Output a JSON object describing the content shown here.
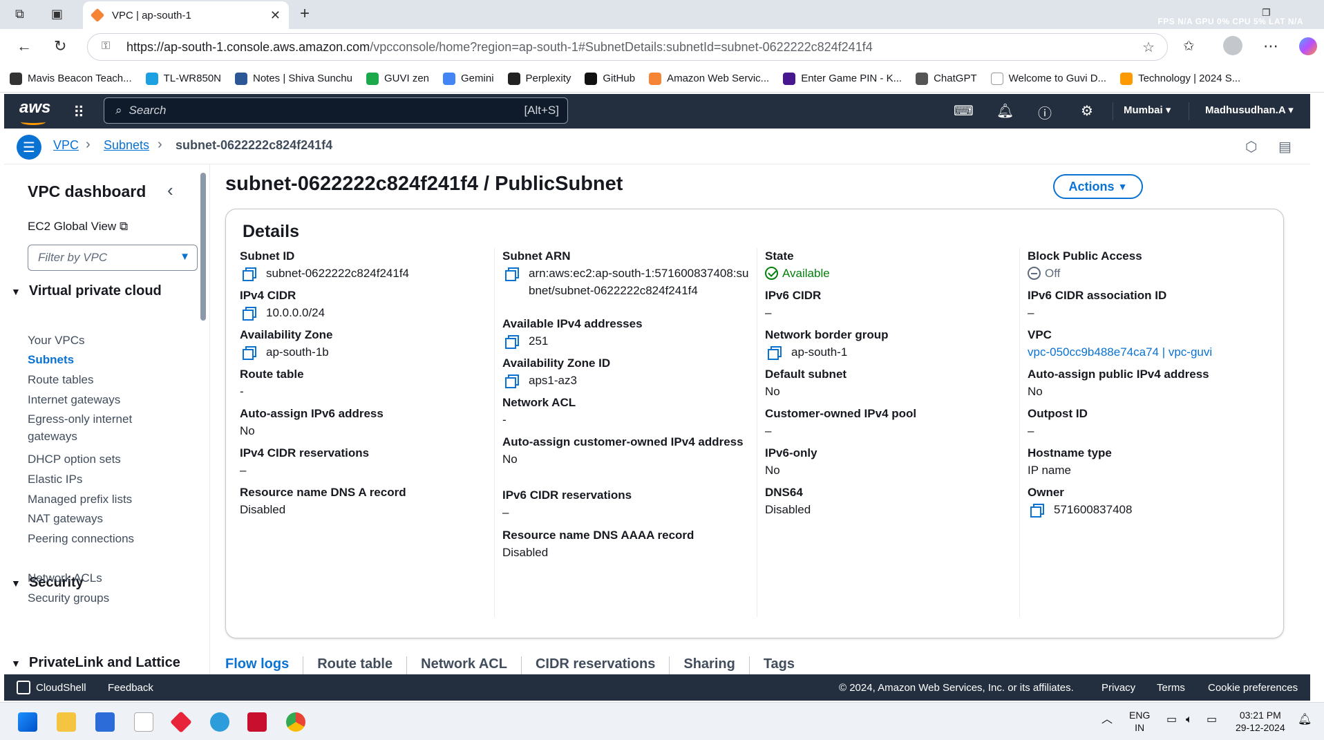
{
  "browser": {
    "tab_title": "VPC | ap-south-1",
    "url_host": "https://ap-south-1.console.aws.amazon.com",
    "url_path": "/vpcconsole/home?region=ap-south-1#SubnetDetails:subnetId=subnet-0622222c824f241f4",
    "perf_overlay": "FPS N/A GPU 0% CPU 5% LAT N/A",
    "bookmarks": [
      {
        "label": "Mavis Beacon Teach...",
        "color": "#333333"
      },
      {
        "label": "TL-WR850N",
        "color": "#1ba1e2"
      },
      {
        "label": "Notes | Shiva Sunchu",
        "color": "#2b5797"
      },
      {
        "label": "GUVI zen",
        "color": "#1ba94c"
      },
      {
        "label": "Gemini",
        "color": "#4285f4"
      },
      {
        "label": "Perplexity",
        "color": "#222222"
      },
      {
        "label": "GitHub",
        "color": "#111111"
      },
      {
        "label": "Amazon Web Servic...",
        "color": "#f58534"
      },
      {
        "label": "Enter Game PIN - K...",
        "color": "#46178f"
      },
      {
        "label": "ChatGPT",
        "color": "#555555"
      },
      {
        "label": "Welcome to Guvi D...",
        "color": "#ffffff"
      },
      {
        "label": "Technology | 2024 S...",
        "color": "#ff9900"
      }
    ]
  },
  "aws": {
    "logo": "aws",
    "search_placeholder": "Search",
    "search_shortcut": "[Alt+S]",
    "region": "Mumbai",
    "user": "Madhusudhan.A"
  },
  "breadcrumb": {
    "items": [
      "VPC",
      "Subnets"
    ],
    "current": "subnet-0622222c824f241f4"
  },
  "sidebar": {
    "title": "VPC dashboard",
    "ec2_link": "EC2 Global View",
    "filter_placeholder": "Filter by VPC",
    "section_vpc": "Virtual private cloud",
    "vpc_items": [
      "Your VPCs",
      "Subnets",
      "Route tables",
      "Internet gateways",
      "Egress-only internet gateways",
      "DHCP option sets",
      "Elastic IPs",
      "Managed prefix lists",
      "NAT gateways",
      "Peering connections"
    ],
    "section_security": "Security",
    "security_items": [
      "Network ACLs",
      "Security groups"
    ],
    "section_privatelink": "PrivateLink and Lattice"
  },
  "page": {
    "title": "subnet-0622222c824f241f4 / PublicSubnet",
    "actions_label": "Actions",
    "details_heading": "Details"
  },
  "details": {
    "col1": [
      {
        "key": "Subnet ID",
        "value": "subnet-0622222c824f241f4",
        "copy": true
      },
      {
        "key": "IPv4 CIDR",
        "value": "10.0.0.0/24",
        "copy": true
      },
      {
        "key": "Availability Zone",
        "value": "ap-south-1b",
        "copy": true
      },
      {
        "key": "Route table",
        "value": "-"
      },
      {
        "key": "Auto-assign IPv6 address",
        "value": "No"
      },
      {
        "key": "IPv4 CIDR reservations",
        "value": "–"
      },
      {
        "key": "Resource name DNS A record",
        "value": "Disabled"
      }
    ],
    "col2": [
      {
        "key": "Subnet ARN",
        "value": "arn:aws:ec2:ap-south-1:571600837408:subnet/subnet-0622222c824f241f4",
        "copy": true
      },
      {
        "key": "Available IPv4 addresses",
        "value": "251",
        "copy": true
      },
      {
        "key": "Availability Zone ID",
        "value": "aps1-az3",
        "copy": true
      },
      {
        "key": "Network ACL",
        "value": "-"
      },
      {
        "key": "Auto-assign customer-owned IPv4 address",
        "value": "No"
      },
      {
        "key": "IPv6 CIDR reservations",
        "value": "–"
      },
      {
        "key": "Resource name DNS AAAA record",
        "value": "Disabled"
      }
    ],
    "col3": [
      {
        "key": "State",
        "value": "Available",
        "status": "ok"
      },
      {
        "key": "IPv6 CIDR",
        "value": "–"
      },
      {
        "key": "Network border group",
        "value": "ap-south-1",
        "copy": true
      },
      {
        "key": "Default subnet",
        "value": "No"
      },
      {
        "key": "Customer-owned IPv4 pool",
        "value": "–"
      },
      {
        "key": "IPv6-only",
        "value": "No"
      },
      {
        "key": "DNS64",
        "value": "Disabled"
      }
    ],
    "col4": [
      {
        "key": "Block Public Access",
        "value": "Off",
        "status": "off"
      },
      {
        "key": "IPv6 CIDR association ID",
        "value": "–"
      },
      {
        "key": "VPC",
        "value": "vpc-050cc9b488e74ca74 | vpc-guvi",
        "link": true
      },
      {
        "key": "Auto-assign public IPv4 address",
        "value": "No"
      },
      {
        "key": "Outpost ID",
        "value": "–"
      },
      {
        "key": "Hostname type",
        "value": "IP name"
      },
      {
        "key": "Owner",
        "value": "571600837408",
        "copy": true
      }
    ]
  },
  "tabs": [
    "Flow logs",
    "Route table",
    "Network ACL",
    "CIDR reservations",
    "Sharing",
    "Tags"
  ],
  "footer": {
    "cloudshell": "CloudShell",
    "feedback": "Feedback",
    "copyright": "© 2024, Amazon Web Services, Inc. or its affiliates.",
    "privacy": "Privacy",
    "terms": "Terms",
    "cookie": "Cookie preferences"
  },
  "taskbar": {
    "lang_top": "ENG",
    "lang_bottom": "IN",
    "time": "03:21 PM",
    "date": "29-12-2024"
  },
  "colors": {
    "aws_navy": "#232f3e",
    "link_blue": "#0972d3",
    "success_green": "#037f0c",
    "aws_orange": "#ff9900"
  }
}
